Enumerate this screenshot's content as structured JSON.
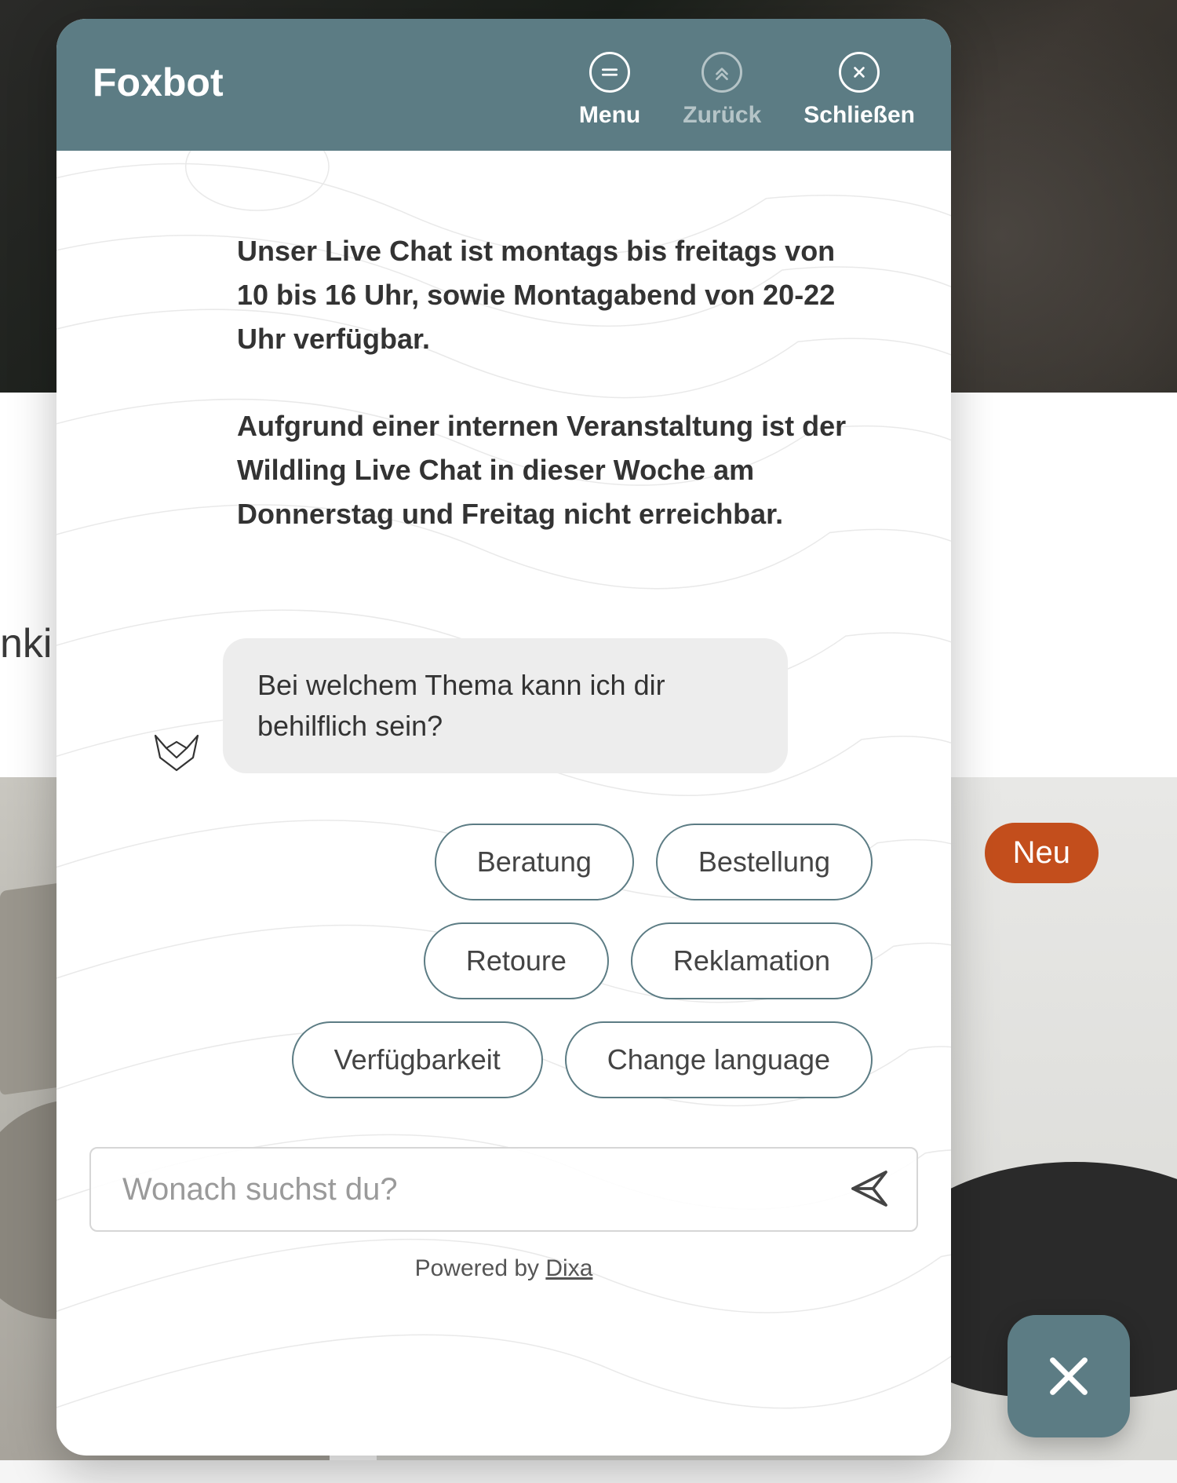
{
  "background": {
    "partial_text": "nki",
    "badge": "Neu"
  },
  "chat": {
    "title": "Foxbot",
    "header": {
      "menu": "Menu",
      "back": "Zurück",
      "close": "Schließen"
    },
    "info": {
      "p1": "Unser Live Chat ist montags bis freitags von 10 bis 16 Uhr, sowie Montagabend von 20-22 Uhr verfügbar.",
      "p2": "Aufgrund einer internen Veranstaltung ist der Wildling Live Chat in dieser Woche am Donnerstag und Freitag nicht erreichbar."
    },
    "bot_message": "Bei welchem Thema kann ich dir behilflich sein?",
    "quick_replies": [
      "Beratung",
      "Bestellung",
      "Retoure",
      "Reklamation",
      "Verfügbarkeit",
      "Change language"
    ],
    "input_placeholder": "Wonach suchst du?",
    "powered_prefix": "Powered by ",
    "powered_link": "Dixa"
  },
  "icons": {
    "menu": "menu-icon",
    "back": "chevron-up-double-icon",
    "close": "close-circle-icon",
    "send": "send-icon",
    "fox": "fox-logo-icon",
    "fab_close": "close-icon"
  },
  "colors": {
    "header_bg": "#5c7c84",
    "accent_badge": "#c34e1c",
    "qr_border": "#5c7c84"
  }
}
